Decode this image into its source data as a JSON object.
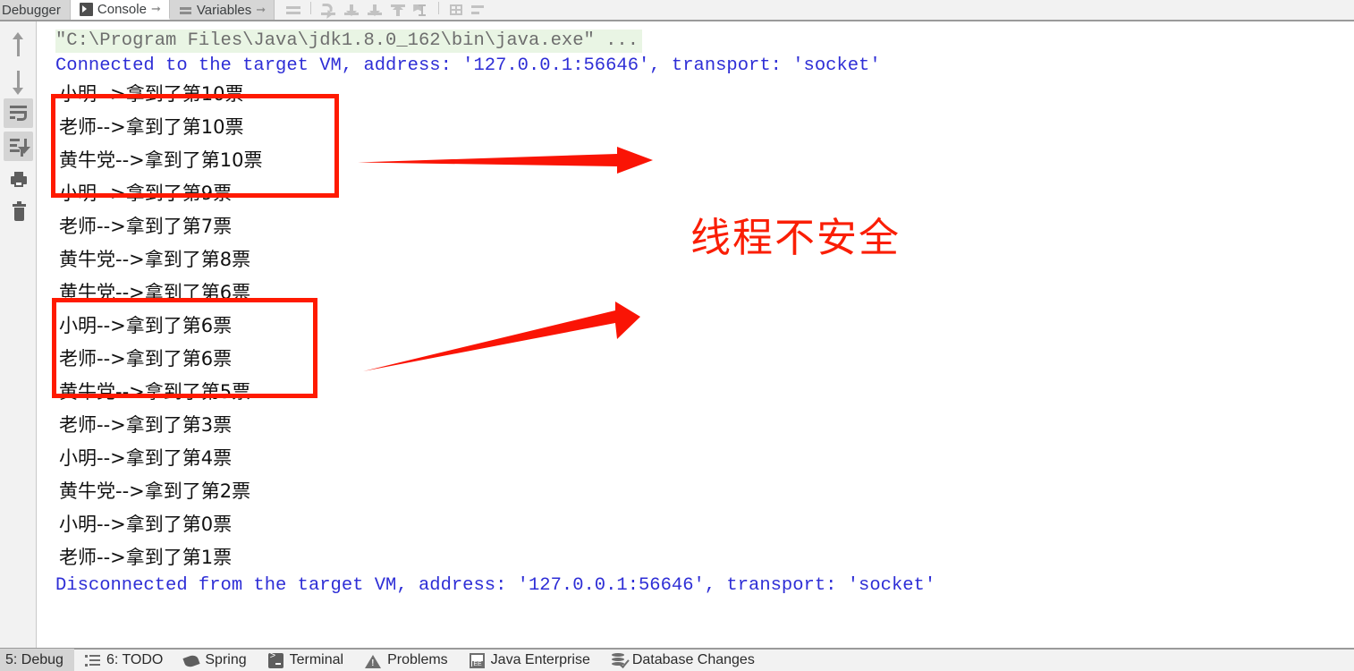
{
  "topbar": {
    "tabs": [
      {
        "label": "Debugger",
        "icon": "none",
        "active": false,
        "pin": false
      },
      {
        "label": "Console",
        "icon": "console-icon",
        "active": true,
        "pin": true
      },
      {
        "label": "Variables",
        "icon": "variables-icon",
        "active": false,
        "pin": true
      }
    ],
    "toolbar_icons": [
      "mute-breakpoints-icon",
      "separator",
      "force-step-into-icon",
      "step-into-icon",
      "step-out-icon",
      "run-to-cursor-icon",
      "evaluate-expression-icon",
      "separator",
      "layout-grid-icon",
      "filter-icon"
    ]
  },
  "gutter": {
    "buttons": [
      {
        "name": "up-arrow-icon",
        "active": false
      },
      {
        "name": "down-arrow-icon",
        "active": false
      },
      {
        "name": "soft-wrap-icon",
        "active": true
      },
      {
        "name": "scroll-to-end-icon",
        "active": true
      },
      {
        "name": "print-icon",
        "active": false
      },
      {
        "name": "trash-icon",
        "active": false
      }
    ]
  },
  "console": {
    "command_line": "\"C:\\Program Files\\Java\\jdk1.8.0_162\\bin\\java.exe\" ...",
    "connected_line": "Connected to the target VM, address: '127.0.0.1:56646', transport: 'socket'",
    "disconnected_line": "Disconnected from the target VM, address: '127.0.0.1:56646', transport: 'socket'",
    "output_lines": [
      "小明-->拿到了第10票",
      "老师-->拿到了第10票",
      "黄牛党-->拿到了第10票",
      "小明-->拿到了第9票",
      "老师-->拿到了第7票",
      "黄牛党-->拿到了第8票",
      "黄牛党-->拿到了第6票",
      "小明-->拿到了第6票",
      "老师-->拿到了第6票",
      "黄牛党-->拿到了第5票",
      "老师-->拿到了第3票",
      "小明-->拿到了第4票",
      "黄牛党-->拿到了第2票",
      "小明-->拿到了第0票",
      "老师-->拿到了第1票"
    ]
  },
  "annotations": {
    "label": "线程不安全",
    "color": "#fa1e05",
    "box_color": "#ff1a00",
    "boxes": [
      {
        "name": "highlight-box-ticket-10"
      },
      {
        "name": "highlight-box-ticket-6"
      }
    ],
    "arrows": [
      {
        "name": "arrow-to-ticket-10"
      },
      {
        "name": "arrow-to-ticket-6"
      }
    ]
  },
  "statusbar": {
    "items": [
      {
        "label": "5: Debug",
        "icon": "none",
        "active": true
      },
      {
        "label": "6: TODO",
        "icon": "todo-icon",
        "active": false
      },
      {
        "label": "Spring",
        "icon": "spring-leaf-icon",
        "active": false
      },
      {
        "label": "Terminal",
        "icon": "terminal-icon",
        "active": false
      },
      {
        "label": "Problems",
        "icon": "warning-triangle-icon",
        "active": false
      },
      {
        "label": "Java Enterprise",
        "icon": "java-ee-icon",
        "active": false
      },
      {
        "label": "Database Changes",
        "icon": "database-check-icon",
        "active": false
      }
    ]
  }
}
